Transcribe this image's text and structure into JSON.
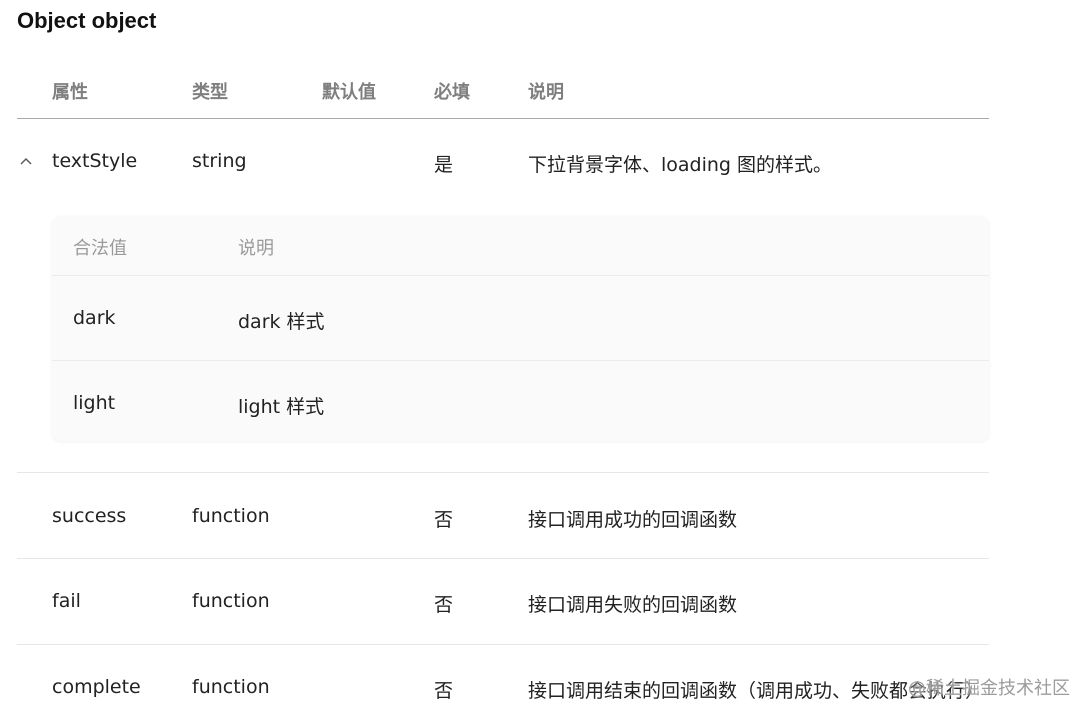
{
  "title": "Object object",
  "columns": [
    "属性",
    "类型",
    "默认值",
    "必填",
    "说明"
  ],
  "rows": [
    {
      "name": "textStyle",
      "type": "string",
      "default": "",
      "required": "是",
      "desc": "下拉背景字体、loading 图的样式。",
      "expanded": true,
      "sub_columns": [
        "合法值",
        "说明"
      ],
      "values": [
        {
          "value": "dark",
          "desc": "dark 样式"
        },
        {
          "value": "light",
          "desc": "light 样式"
        }
      ]
    },
    {
      "name": "success",
      "type": "function",
      "default": "",
      "required": "否",
      "desc": "接口调用成功的回调函数"
    },
    {
      "name": "fail",
      "type": "function",
      "default": "",
      "required": "否",
      "desc": "接口调用失败的回调函数"
    },
    {
      "name": "complete",
      "type": "function",
      "default": "",
      "required": "否",
      "desc": "接口调用结束的回调函数（调用成功、失败都会执行）"
    }
  ],
  "watermark": "@稀土掘金技术社区",
  "icons": {
    "collapse": "chevron-up-icon"
  }
}
